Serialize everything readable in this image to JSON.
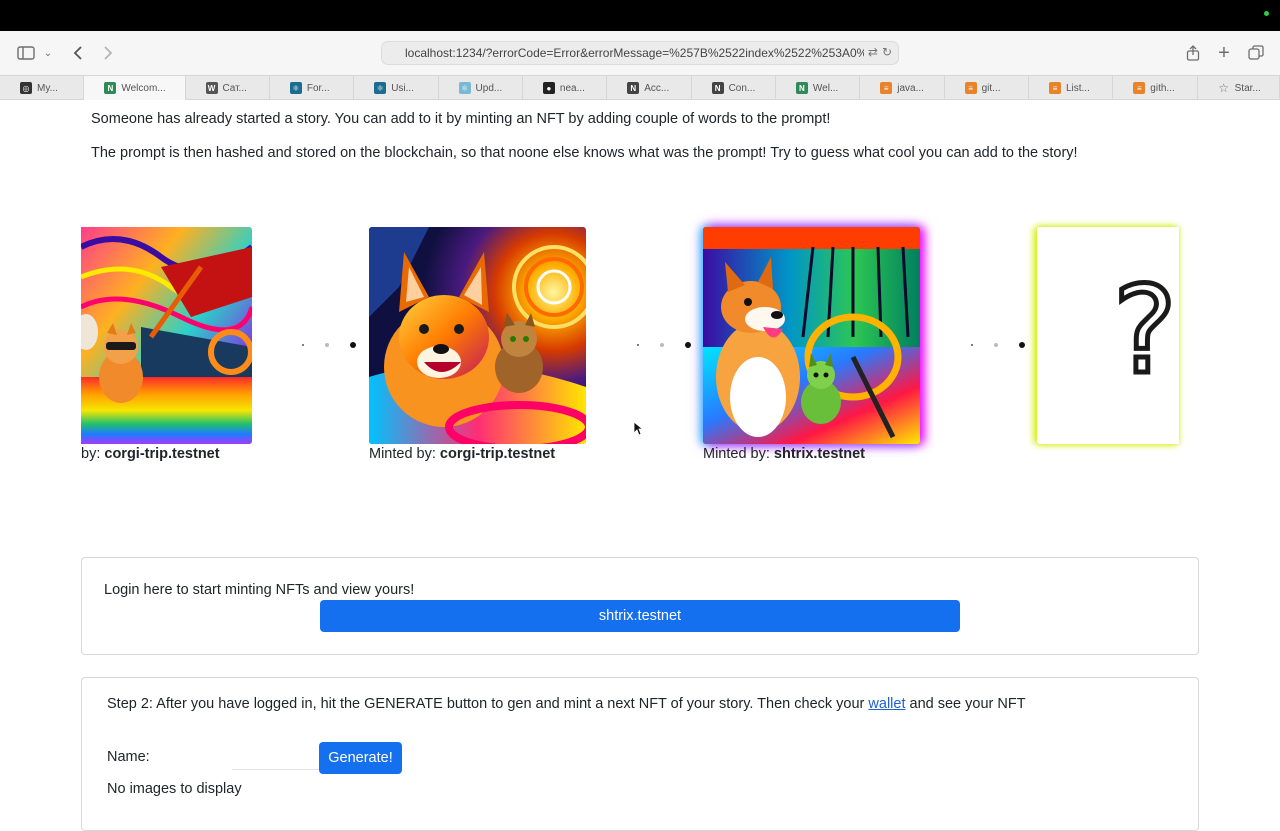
{
  "browser": {
    "url": "localhost:1234/?errorCode=Error&errorMessage=%257B%2522index%2522%253A0%",
    "tabs": [
      {
        "label": "My...",
        "icon": "app-icon",
        "color": "#333333"
      },
      {
        "label": "Welcom...",
        "icon": "notion-icon",
        "color": "#2e8b57"
      },
      {
        "label": "Cат...",
        "icon": "wikipedia-icon",
        "color": "#555555"
      },
      {
        "label": "For...",
        "icon": "react-icon",
        "color": "#1b6d8f"
      },
      {
        "label": "Usi...",
        "icon": "react-icon",
        "color": "#1b6d8f"
      },
      {
        "label": "Upd...",
        "icon": "react-light-icon",
        "color": "#7ab8d6"
      },
      {
        "label": "nea...",
        "icon": "github-icon",
        "color": "#222222"
      },
      {
        "label": "Acc...",
        "icon": "near-icon",
        "color": "#444444"
      },
      {
        "label": "Con...",
        "icon": "near-icon",
        "color": "#444444"
      },
      {
        "label": "Wel...",
        "icon": "notion-icon",
        "color": "#2e8b57"
      },
      {
        "label": "java...",
        "icon": "stackoverflow-icon",
        "color": "#e8832a"
      },
      {
        "label": "git...",
        "icon": "stackoverflow-icon",
        "color": "#e8832a"
      },
      {
        "label": "List...",
        "icon": "stackoverflow-icon",
        "color": "#e8832a"
      },
      {
        "label": "gith...",
        "icon": "stackoverflow-icon",
        "color": "#e8832a"
      },
      {
        "label": "Star...",
        "icon": "star-icon",
        "color": "#777777"
      }
    ]
  },
  "intro": {
    "line1": "Someone has already started a story. You can add to it by minting an NFT by adding couple of words to the prompt!",
    "line2": "The prompt is then hashed and stored on the blockchain, so that noone else knows what was the prompt! Try to guess what cool you can add to the story!"
  },
  "gallery": [
    {
      "prefix": "by: ",
      "minter": "corgi-trip.testnet"
    },
    {
      "prefix": "Minted by: ",
      "minter": "corgi-trip.testnet"
    },
    {
      "prefix": "Minted by: ",
      "minter": "shtrix.testnet"
    }
  ],
  "mystery": {
    "symbol": "?"
  },
  "login": {
    "text": "Login here to start minting NFTs and view yours!",
    "account_button": "shtrix.testnet"
  },
  "step2": {
    "text_before": "Step 2: After you have logged in, hit the GENERATE button to gen and mint a next NFT of your story. Then check your ",
    "link": "wallet",
    "text_after": " and see your NFT",
    "name_label": "Name:",
    "name_value": "",
    "generate_button": "Generate!",
    "empty_message": "No images to display"
  },
  "colors": {
    "primary": "#1570ef",
    "link": "#1f5fd0"
  }
}
